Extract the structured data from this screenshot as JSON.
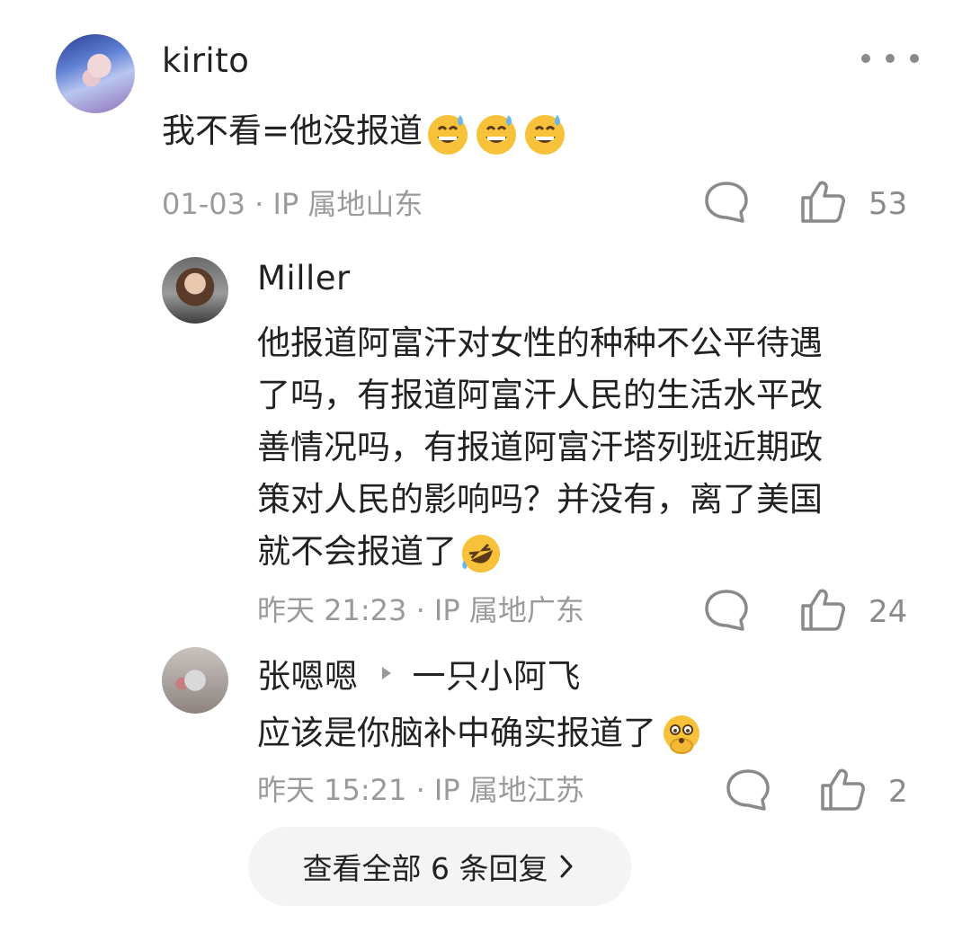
{
  "main_comment": {
    "username": "kirito",
    "text": "我不看=他没报道",
    "emoji": [
      "grinning-sweat-emoji",
      "grinning-sweat-emoji",
      "grinning-sweat-emoji"
    ],
    "meta": "01-03 · IP 属地山东",
    "like_count": "53"
  },
  "replies": [
    {
      "username": "Miller",
      "text_lines": [
        "他报道阿富汗对女性的种种不公平待遇",
        "了吗，有报道阿富汗人民的生活水平改",
        "善情况吗，有报道阿富汗塔列班近期政",
        "策对人民的影响吗？并没有，离了美国",
        "就不会报道了"
      ],
      "emoji": "rolling-laugh-emoji",
      "meta": "昨天 21:23 · IP 属地广东",
      "like_count": "24"
    },
    {
      "username": "张嗯嗯",
      "reply_to": "一只小阿飞",
      "text": "应该是你脑补中确实报道了",
      "emoji": "face-with-hand-emoji",
      "meta": "昨天 15:21 · IP 属地江苏",
      "like_count": "2"
    }
  ],
  "view_all_replies": "查看全部 6 条回复",
  "colors": {
    "text": "#222222",
    "meta": "#9a9a9a",
    "pill_bg": "#f4f4f4"
  }
}
